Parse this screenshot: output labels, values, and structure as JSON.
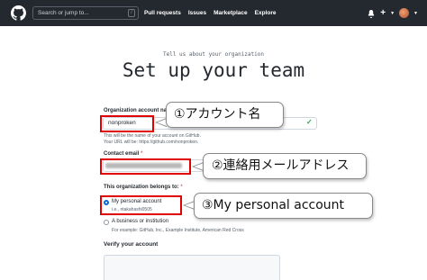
{
  "header": {
    "search_placeholder": "Search or jump to...",
    "slash_key": "/",
    "nav": [
      "Pull requests",
      "Issues",
      "Marketplace",
      "Explore"
    ],
    "plus": "+"
  },
  "page": {
    "tagline": "Tell us about your organization",
    "title": "Set up your team"
  },
  "form": {
    "org_name_label": "Organization account name",
    "required_mark": "*",
    "org_name_value": "nonproken",
    "org_note_1": "This will be the name of your account on GitHub.",
    "org_note_2": "Your URL will be: https://github.com/nonproken.",
    "contact_label": "Contact email",
    "belongs_label": "This organization belongs to:",
    "option_personal": "My personal account",
    "option_personal_sub": "i.e., ntakahashi0505",
    "option_business": "A business or institution",
    "option_business_sub": "For example: GitHub, Inc., Example Institute, American Red Cross",
    "verify_label": "Verify your account"
  },
  "annotations": {
    "callout_1": "①アカウント名",
    "callout_2": "②連絡用メールアドレス",
    "callout_3": "③My personal account",
    "highlight_color": "#e00000"
  }
}
